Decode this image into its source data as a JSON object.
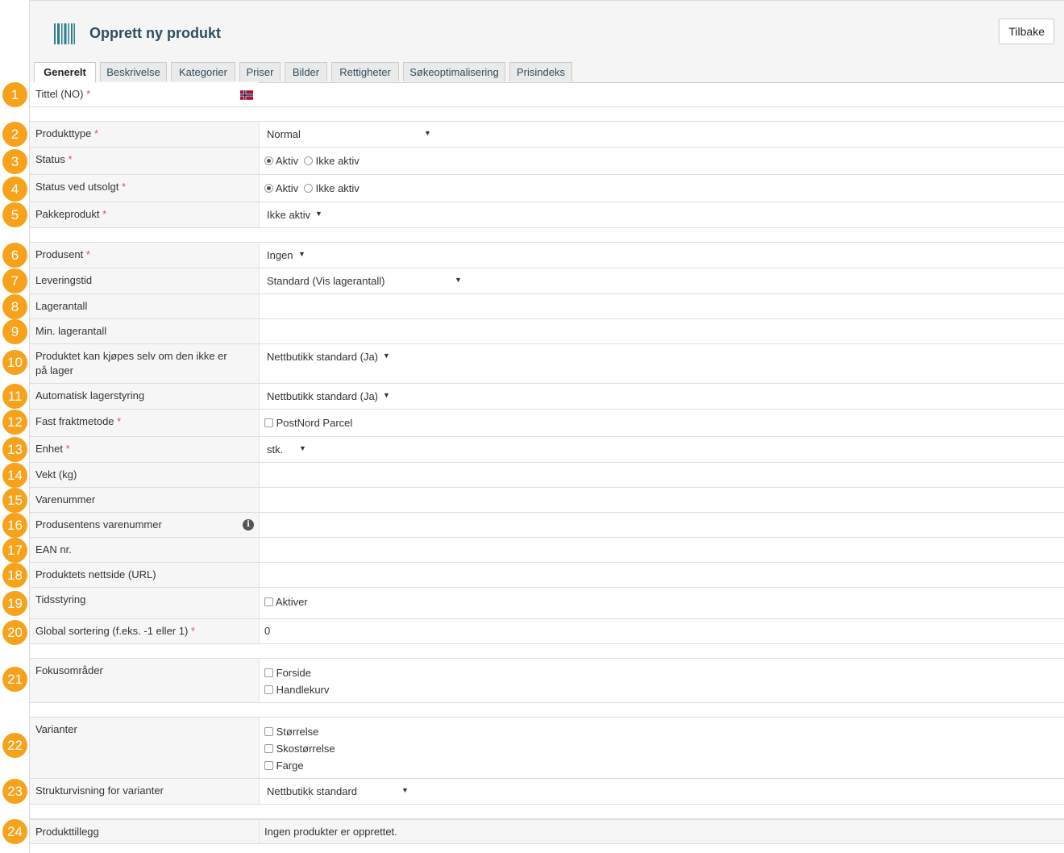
{
  "header": {
    "title": "Opprett ny produkt",
    "back_label": "Tilbake",
    "icon": "barcode-icon"
  },
  "tabs": [
    "Generelt",
    "Beskrivelse",
    "Kategorier",
    "Priser",
    "Bilder",
    "Rettigheter",
    "Søkeoptimalisering",
    "Prisindeks"
  ],
  "active_tab": "Generelt",
  "badges": [
    "1",
    "2",
    "3",
    "4",
    "5",
    "6",
    "7",
    "8",
    "9",
    "10",
    "11",
    "12",
    "13",
    "14",
    "15",
    "16",
    "17",
    "18",
    "19",
    "20",
    "21",
    "22",
    "23",
    "24"
  ],
  "colors": {
    "badge": "#f7a21b",
    "required": "#e05050",
    "title": "#2e4e5e"
  },
  "form": {
    "tittel": {
      "label": "Tittel (NO)",
      "req": "*"
    },
    "produkttype": {
      "label": "Produkttype",
      "req": "*",
      "value": "Normal"
    },
    "status": {
      "label": "Status",
      "req": "*",
      "opt1": "Aktiv",
      "opt2": "Ikke aktiv"
    },
    "status_utsolgt": {
      "label": "Status ved utsolgt",
      "req": "*",
      "opt1": "Aktiv",
      "opt2": "Ikke aktiv"
    },
    "pakkeprodukt": {
      "label": "Pakkeprodukt",
      "req": "*",
      "value": "Ikke aktiv"
    },
    "produsent": {
      "label": "Produsent",
      "req": "*",
      "value": "Ingen"
    },
    "leveringstid": {
      "label": "Leveringstid",
      "value": "Standard (Vis lagerantall)"
    },
    "lagerantall": {
      "label": "Lagerantall"
    },
    "min_lagerantall": {
      "label": "Min. lagerantall"
    },
    "kjopes_uten_lager": {
      "label": "Produktet kan kjøpes selv om den ikke er på lager",
      "value": "Nettbutikk standard (Ja)"
    },
    "auto_lager": {
      "label": "Automatisk lagerstyring",
      "value": "Nettbutikk standard (Ja)"
    },
    "fraktmetode": {
      "label": "Fast fraktmetode",
      "req": "*",
      "opt1": "PostNord Parcel"
    },
    "enhet": {
      "label": "Enhet",
      "req": "*",
      "value": "stk."
    },
    "vekt": {
      "label": "Vekt (kg)"
    },
    "varenummer": {
      "label": "Varenummer"
    },
    "prod_varenummer": {
      "label": "Produsentens varenummer"
    },
    "ean": {
      "label": "EAN nr."
    },
    "nettside": {
      "label": "Produktets nettside (URL)"
    },
    "tidsstyring": {
      "label": "Tidsstyring",
      "opt1": "Aktiver"
    },
    "sortering": {
      "label": "Global sortering (f.eks. -1 eller 1)",
      "req": "*",
      "value": "0"
    },
    "fokus": {
      "label": "Fokusområder",
      "opt1": "Forside",
      "opt2": "Handlekurv"
    },
    "varianter": {
      "label": "Varianter",
      "opt1": "Størrelse",
      "opt2": "Skostørrelse",
      "opt3": "Farge"
    },
    "strukturvisning": {
      "label": "Strukturvisning for varianter",
      "value": "Nettbutikk standard"
    },
    "produkttillegg": {
      "label": "Produkttillegg",
      "value": "Ingen produkter er opprettet."
    }
  }
}
